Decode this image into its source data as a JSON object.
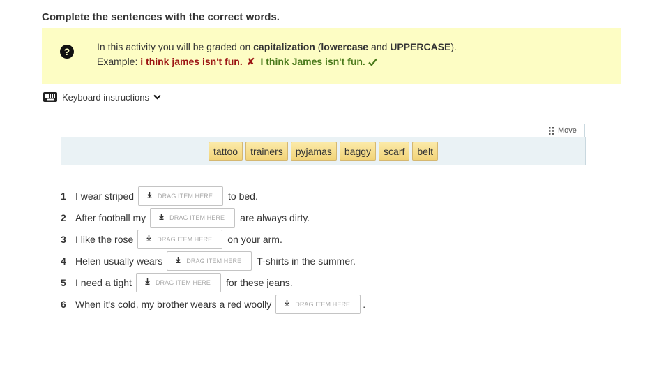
{
  "instruction": "Complete the sentences with the correct words.",
  "info": {
    "intro": "In this activity you will be graded on ",
    "bold1": "capitalization",
    "mid1": " (",
    "bold2": "lowercase",
    "mid2": " and ",
    "bold3": "UPPERCASE",
    "end": ").",
    "example_label": "Example: ",
    "wrong_word1": "i",
    "wrong_gap1": " think ",
    "wrong_word2": "james",
    "wrong_rest": " isn't fun.",
    "x_mark": "✘",
    "right_text": "I think James isn't fun."
  },
  "keyboard": {
    "label": "Keyboard instructions"
  },
  "move": {
    "label": "Move"
  },
  "word_bank": [
    "tattoo",
    "trainers",
    "pyjamas",
    "baggy",
    "scarf",
    "belt"
  ],
  "drop_placeholder": "DRAG ITEM HERE",
  "questions": [
    {
      "num": "1",
      "before": "I wear striped",
      "after": "to bed."
    },
    {
      "num": "2",
      "before": "After football my",
      "after": "are always dirty."
    },
    {
      "num": "3",
      "before": "I like the rose",
      "after": "on your arm."
    },
    {
      "num": "4",
      "before": "Helen usually wears",
      "after": "T-shirts in the summer."
    },
    {
      "num": "5",
      "before": "I need a tight",
      "after": "for these jeans."
    },
    {
      "num": "6",
      "before": "When it's cold, my brother wears a red woolly",
      "after": "."
    }
  ],
  "colors": {
    "info_bg": "#fdfdc4",
    "wrong": "#9b1414",
    "right": "#4b7a1c",
    "tile": "#f2d479",
    "bank_bg": "#eaf2f5"
  }
}
